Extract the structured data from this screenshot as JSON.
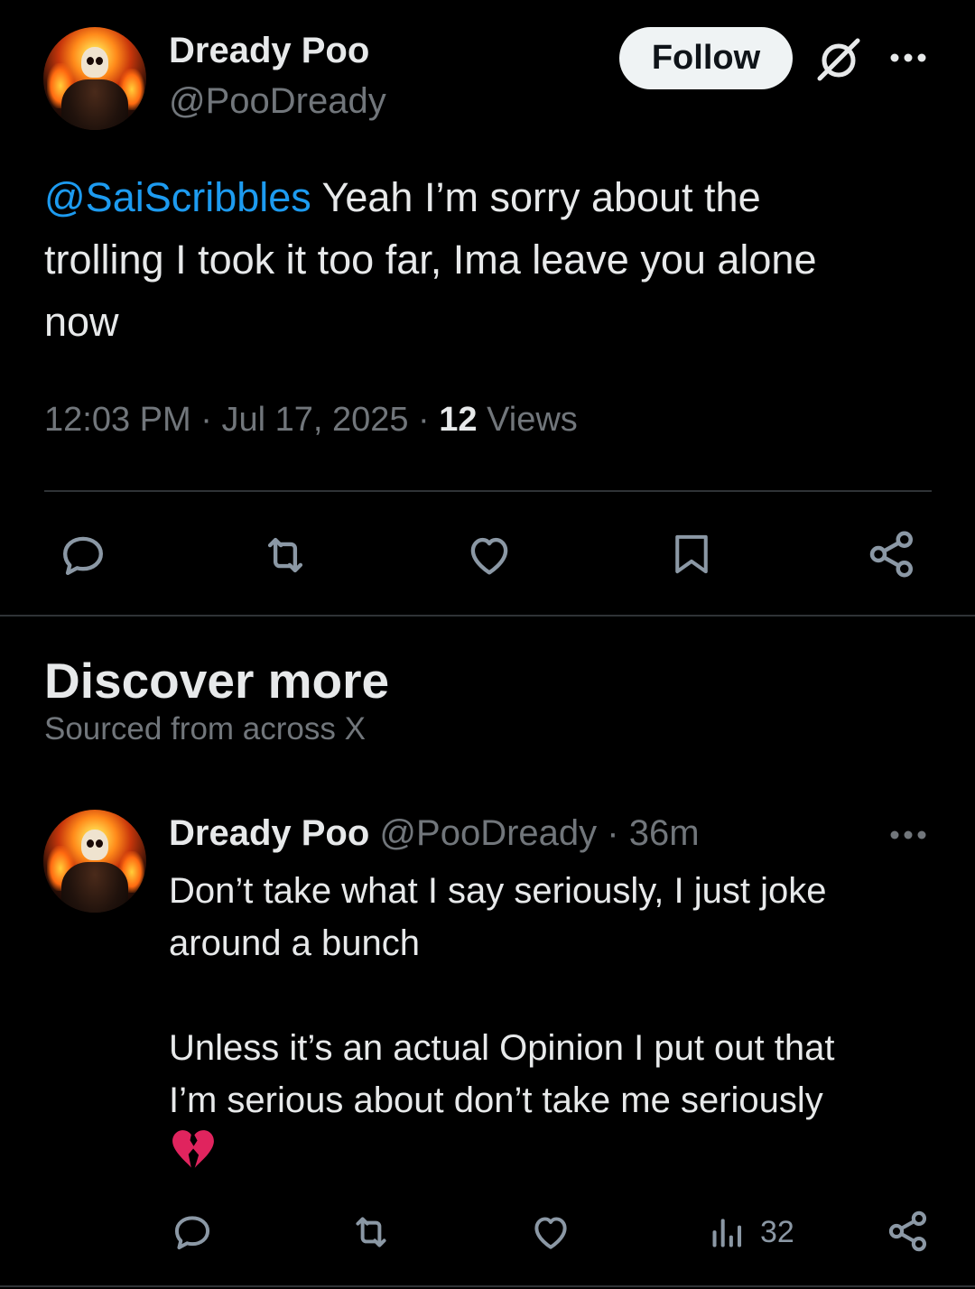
{
  "tweet": {
    "author_name": "Dready Poo",
    "author_handle": "@PooDready",
    "follow_label": "Follow",
    "mention": "@SaiScribbles",
    "text_line1": " Yeah I’m sorry about the",
    "text_line2": "trolling I took it too far, Ima leave you alone",
    "text_line3": "now",
    "time": "12:03 PM",
    "date": "Jul 17, 2025",
    "views_count": "12",
    "views_label": "Views",
    "sep": " · "
  },
  "discover": {
    "title": "Discover more",
    "subtitle": "Sourced from across X"
  },
  "reply": {
    "author_name": "Dready Poo",
    "author_handle": "@PooDready",
    "sep": " · ",
    "age": "36m",
    "line1": "Don’t take what I say seriously, I just joke",
    "line2": "around a bunch",
    "line3": "Unless it’s an actual Opinion I put out that",
    "line4": "I’m serious about don’t take me seriously",
    "emoji": "💔",
    "views_count": "32"
  },
  "icons": {
    "grok": "grok-icon",
    "more": "more-icon",
    "reply": "reply-icon",
    "retweet": "retweet-icon",
    "like": "like-icon",
    "bookmark": "bookmark-icon",
    "share": "share-icon",
    "views": "views-icon"
  },
  "colors": {
    "background": "#000000",
    "text": "#e7e9ea",
    "muted": "#71767b",
    "link": "#1d9bf0",
    "divider": "#2f3336",
    "broken_heart": "#e0245e"
  }
}
